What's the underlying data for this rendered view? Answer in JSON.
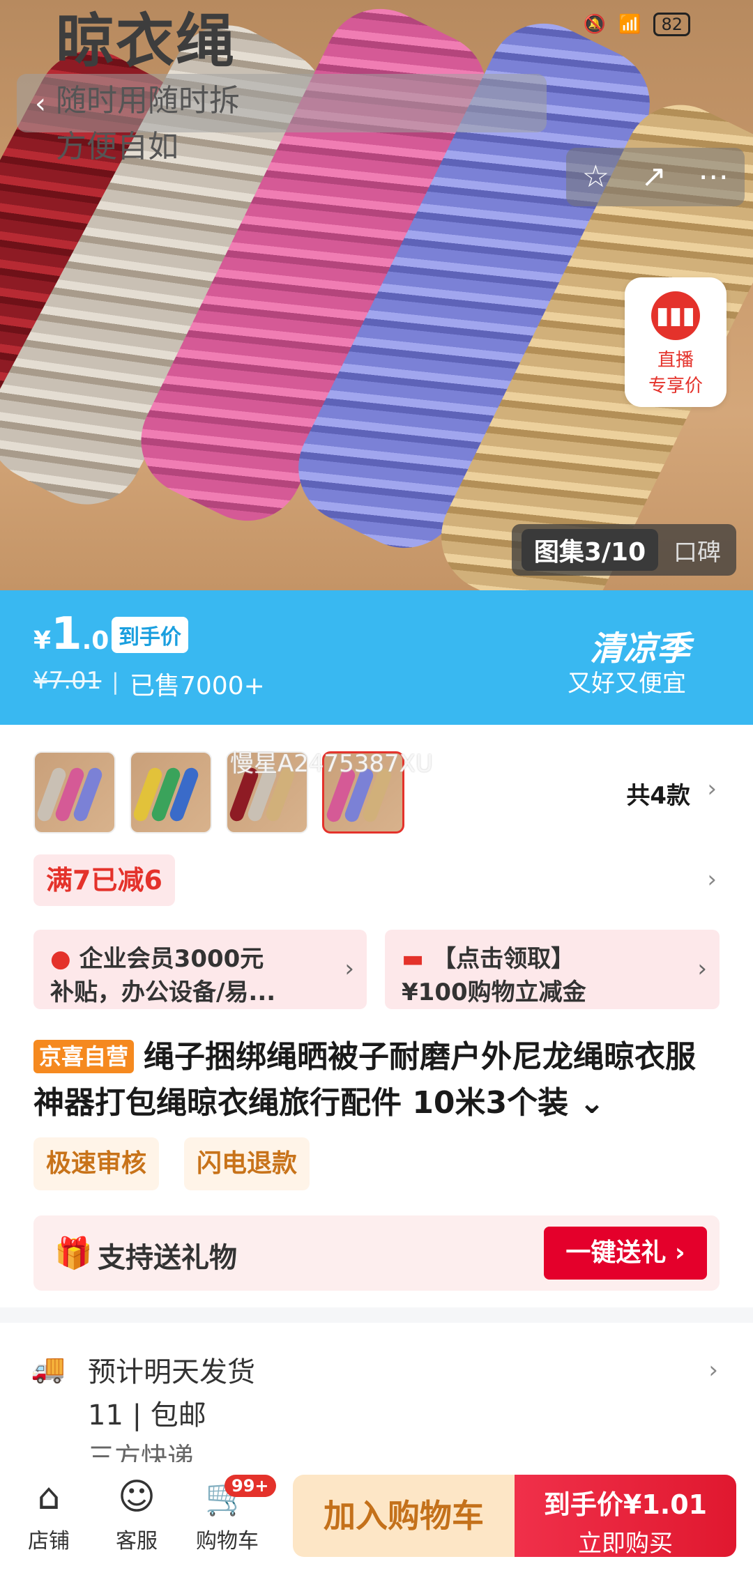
{
  "status_bar": {
    "battery": "82"
  },
  "hero": {
    "title": "晾衣绳",
    "subtitle1": "随时用随时拆",
    "subtitle2": "方便自如",
    "live": {
      "label1": "直播",
      "label2": "专享价"
    },
    "gallery": {
      "active": "图集3/10",
      "other": "口碑"
    }
  },
  "icons": {
    "back": "chevron-left-icon",
    "star": "star-icon",
    "share": "share-icon",
    "more": "more-icon"
  },
  "price": {
    "currency": "¥",
    "integer": "1",
    "decimal": ".01",
    "tag": "到手价",
    "original": "¥7.01",
    "separator": "|",
    "sold": "已售7000+",
    "season_title": "清凉季",
    "season_sub": "又好又便宜",
    "banner_color": "#39b8f1"
  },
  "variants": {
    "watermark": "慢星A2475387XU",
    "count": "共4款"
  },
  "promo": {
    "label": "满7已减6"
  },
  "coupons": [
    {
      "line1": "企业会员3000元",
      "line2": "补贴，办公设备/易..."
    },
    {
      "line1": "【点击领取】",
      "line2": "¥100购物立减金"
    }
  ],
  "product": {
    "badge": "京喜自营",
    "title": "绳子捆绑绳晒被子耐磨户外尼龙绳晾衣服神器打包绳晾衣绳旅行配件 10米3个装"
  },
  "tags": [
    "极速审核",
    "闪电退款"
  ],
  "gift": {
    "label": "支持送礼物",
    "button": "一键送礼 ›"
  },
  "shipping": {
    "line1": "预计明天发货",
    "line2": "11 | 包邮",
    "line3": "三方快递"
  },
  "bottom_bar": {
    "shop": "店铺",
    "service": "客服",
    "cart": "购物车",
    "cart_badge": "99+",
    "add_to_cart": "加入购物车",
    "buy_line1": "到手价¥1.01",
    "buy_line2": "立即购买"
  },
  "colors": {
    "accent_red": "#e4322b",
    "jd_orange": "#f5891f"
  }
}
